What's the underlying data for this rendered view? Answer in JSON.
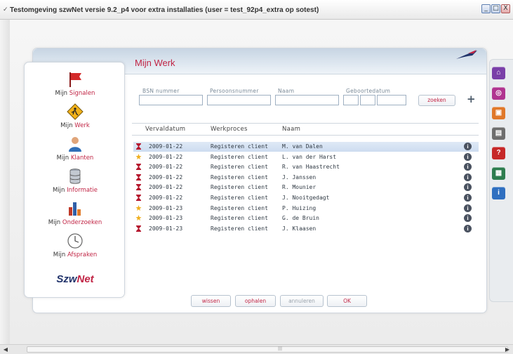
{
  "window": {
    "title": "Testomgeving szwNet versie 9.2_p4 voor extra installaties (user = test_92p4_extra op sotest)",
    "min_label": "_",
    "max_label": "□",
    "close_label": "X"
  },
  "page": {
    "title": "Mijn Werk"
  },
  "nav": {
    "items": [
      {
        "prefix": "Mijn ",
        "accent": "Signalen",
        "icon": "red-flag-icon"
      },
      {
        "prefix": "Mijn ",
        "accent": "Werk",
        "icon": "worker-sign-icon"
      },
      {
        "prefix": "Mijn ",
        "accent": "Klanten",
        "icon": "person-icon"
      },
      {
        "prefix": "Mijn ",
        "accent": "Informatie",
        "icon": "database-icon"
      },
      {
        "prefix": "Mijn ",
        "accent": "Onderzoeken",
        "icon": "bar-chart-icon"
      },
      {
        "prefix": "Mijn ",
        "accent": "Afspraken",
        "icon": "clock-icon"
      }
    ],
    "brand_main": "Szw",
    "brand_accent": "Net"
  },
  "search": {
    "bsn_label": "BSN nummer",
    "persoonsnummer_label": "Persoonsnummer",
    "naam_label": "Naam",
    "geboortedatum_label": "Geboortedatum",
    "zoeken_label": "zoeken",
    "add_label": "+"
  },
  "table": {
    "headers": [
      "Vervaldatum",
      "Werkproces",
      "Naam"
    ],
    "rows": [
      {
        "status": "hourglass",
        "date": "2009-01-22",
        "proc": "Registeren client",
        "naam": "M. van Dalen",
        "selected": true
      },
      {
        "status": "star",
        "date": "2009-01-22",
        "proc": "Registeren client",
        "naam": "L. van der Harst"
      },
      {
        "status": "hourglass",
        "date": "2009-01-22",
        "proc": "Registeren client",
        "naam": "R. van Haastrecht"
      },
      {
        "status": "hourglass",
        "date": "2009-01-22",
        "proc": "Registeren client",
        "naam": "J. Janssen"
      },
      {
        "status": "hourglass",
        "date": "2009-01-22",
        "proc": "Registeren client",
        "naam": "R. Mounier"
      },
      {
        "status": "hourglass",
        "date": "2009-01-22",
        "proc": "Registeren client",
        "naam": "J. Nooitgedagt"
      },
      {
        "status": "star",
        "date": "2009-01-23",
        "proc": "Registeren client",
        "naam": "P. Huizing"
      },
      {
        "status": "star",
        "date": "2009-01-23",
        "proc": "Registeren client",
        "naam": "G. de Bruin"
      },
      {
        "status": "hourglass",
        "date": "2009-01-23",
        "proc": "Registeren client",
        "naam": "J. Klaasen"
      }
    ],
    "info_glyph": "i"
  },
  "buttons": {
    "wissen": "wissen",
    "ophalen": "ophalen",
    "annuleren": "annuleren",
    "ok": "OK"
  },
  "toolbar": {
    "items": [
      {
        "icon": "home-icon",
        "glyph": "⌂",
        "color": "#7a3fa8"
      },
      {
        "icon": "target-icon",
        "glyph": "◎",
        "color": "#b03490"
      },
      {
        "icon": "lock-icon",
        "glyph": "▣",
        "color": "#e0782a"
      },
      {
        "icon": "document-icon",
        "glyph": "▤",
        "color": "#6e6e6e"
      },
      {
        "icon": "help-icon",
        "glyph": "?",
        "color": "#c62828"
      },
      {
        "icon": "calculator-icon",
        "glyph": "▦",
        "color": "#2e7d4f"
      },
      {
        "icon": "info-icon",
        "glyph": "i",
        "color": "#2f6fc0"
      }
    ]
  },
  "colors": {
    "accent": "#c12545",
    "brand_blue": "#22346b",
    "selected_row": "#d6e3f3"
  }
}
